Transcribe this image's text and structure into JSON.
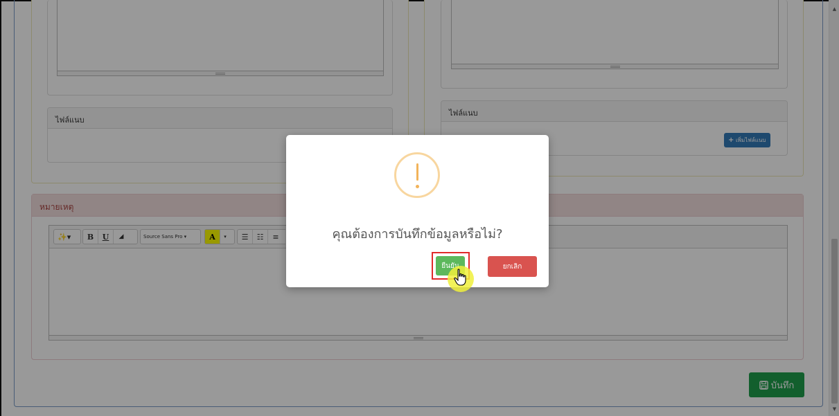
{
  "left_panel": {
    "attachment_heading": "ไฟล์แนบ"
  },
  "right_panel": {
    "attachment_heading": "ไฟล์แนบ",
    "add_attachment_label": "เพิ่มไฟล์แนบ"
  },
  "remarks": {
    "heading": "หมายเหตุ",
    "toolbar": {
      "magic_label": "✨▾",
      "bold_label": "B",
      "underline_label": "U",
      "eraser_label": "◢",
      "font_name": "Source Sans Pro ▾",
      "color_label": "A",
      "color_caret": "▾",
      "ul_label": "☰",
      "ol_label": "☷",
      "align_label": "≡"
    }
  },
  "save_button": {
    "label": "บันทึก"
  },
  "modal": {
    "title": "คุณต้องการบันทึกข้อมูลหรือไม่?",
    "confirm_label": "ยืนยัน",
    "cancel_label": "ยกเลิก"
  },
  "colors": {
    "save_green": "#1e9e4c",
    "confirm_green": "#5cb85c",
    "cancel_red": "#d9534f",
    "warning_orange": "#f8d69f",
    "remark_header_bg": "#f2dede",
    "primary_blue": "#337ab7"
  },
  "icons": {
    "warning": "warning-icon",
    "save": "floppy-disk-icon",
    "plus": "plus-icon",
    "cursor": "hand-pointer-icon"
  }
}
